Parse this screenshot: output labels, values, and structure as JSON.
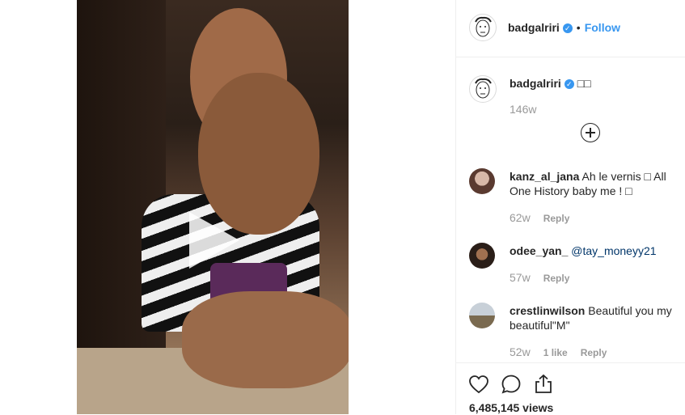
{
  "post": {
    "author": "badgalriri",
    "follow_label": "Follow",
    "dot": "•",
    "caption_text": "□□",
    "caption_time": "146w"
  },
  "comments": [
    {
      "user": "kanz_al_jana",
      "text": "Ah le vernis □ All One History baby me ! □",
      "time": "62w",
      "likes": "",
      "reply_label": "Reply"
    },
    {
      "user": "odee_yan_",
      "mention": "@tay_moneyy21",
      "text": "",
      "time": "57w",
      "likes": "",
      "reply_label": "Reply"
    },
    {
      "user": "crestlinwilson",
      "text": "Beautiful you my beautiful\"M\"",
      "time": "52w",
      "likes": "1 like",
      "reply_label": "Reply"
    }
  ],
  "actions": {
    "icons": [
      "heart-icon",
      "comment-icon",
      "share-icon"
    ],
    "views": "6,485,145 views"
  },
  "colors": {
    "link": "#3897f0",
    "verified": "#3897f0",
    "muted": "#999999",
    "text": "#262626"
  }
}
